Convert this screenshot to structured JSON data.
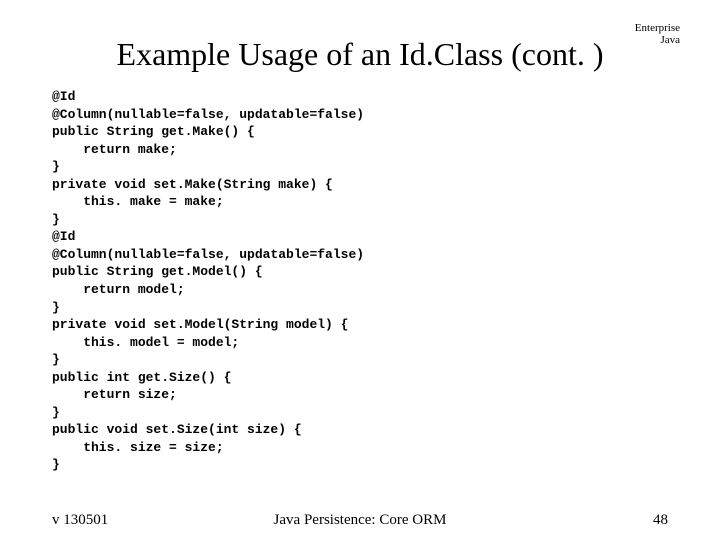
{
  "corner": {
    "line1": "Enterprise",
    "line2": "Java"
  },
  "title": "Example Usage of an Id.Class (cont. )",
  "code": "@Id\n@Column(nullable=false, updatable=false)\npublic String get.Make() {\n    return make;\n}\nprivate void set.Make(String make) {\n    this. make = make;\n}\n@Id\n@Column(nullable=false, updatable=false)\npublic String get.Model() {\n    return model;\n}\nprivate void set.Model(String model) {\n    this. model = model;\n}\npublic int get.Size() {\n    return size;\n}\npublic void set.Size(int size) {\n    this. size = size;\n}",
  "footer": {
    "left": "v 130501",
    "center": "Java Persistence: Core ORM",
    "right": "48"
  }
}
